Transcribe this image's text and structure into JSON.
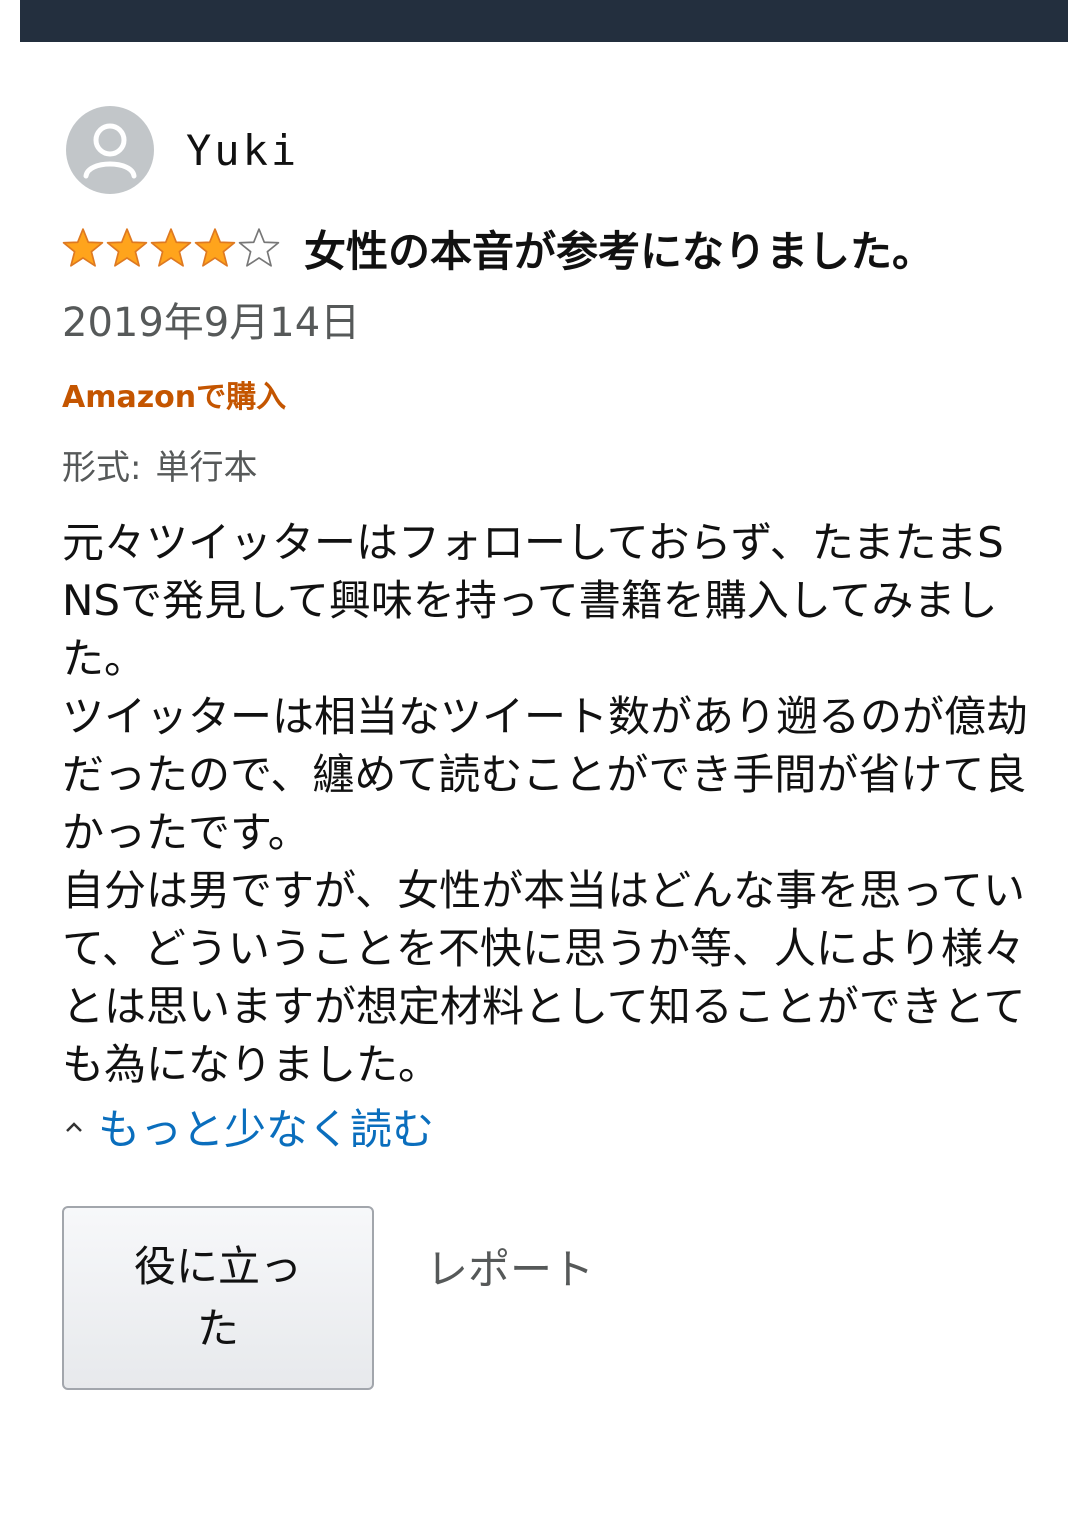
{
  "header": {
    "bar_color": "#232f3e"
  },
  "reviewer": {
    "name": "Yuki",
    "avatar_icon": "user-silhouette-icon"
  },
  "review": {
    "rating": 4,
    "rating_max": 5,
    "star_color": "#ffa41c",
    "title": "女性の本音が参考になりました。",
    "date": "2019年9月14日",
    "verified_label": "Amazonで購入",
    "format_label": "形式:",
    "format_value": "単行本",
    "body": "元々ツイッターはフォローしておらず、たまたまSNSで発見して興味を持って書籍を購入してみました。\nツイッターは相当なツイート数があり遡るのが億劫だったので、纏めて読むことができ手間が省けて良かったです。\n自分は男ですが、女性が本当はどんな事を思っていて、どういうことを不快に思うか等、人により様々とは思いますが想定材料として知ることができとても為になりました。"
  },
  "actions": {
    "read_less_icon": "chevron-up-icon",
    "read_less_label": "もっと少なく読む",
    "helpful_label": "役に立った",
    "report_label": "レポート",
    "link_color": "#0a6ebd"
  }
}
